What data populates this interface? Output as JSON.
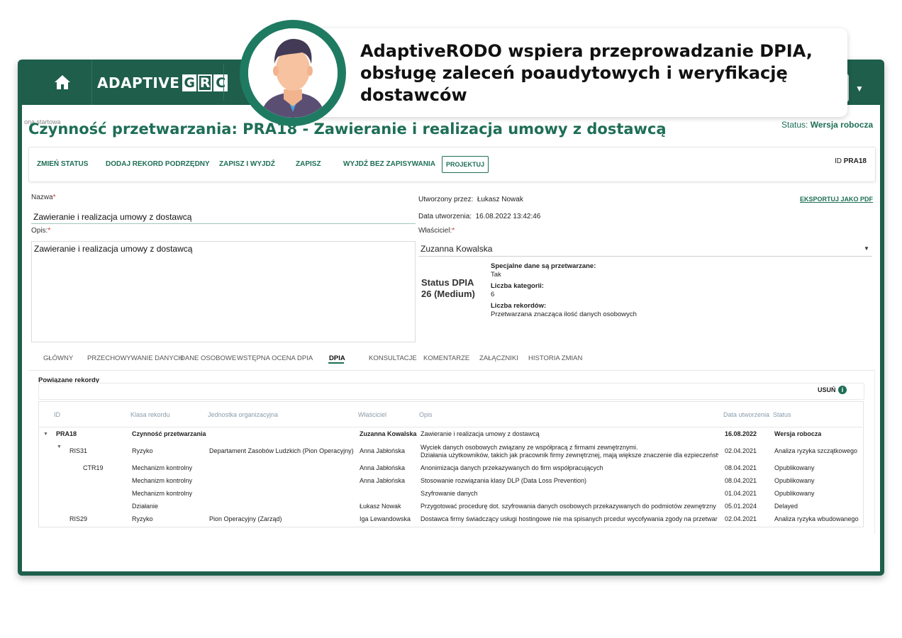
{
  "callout": {
    "text": "AdaptiveRODO wspiera przeprowadzanie DPIA, obsługę zaleceń poaudytowych i weryfikację dostawców"
  },
  "app": {
    "logo_text": "ADAPTIVE",
    "logo_letters": [
      "G",
      "R",
      "C"
    ],
    "accent_color": "#1e6e56"
  },
  "breadcrumb": "ona startowa",
  "page": {
    "title": "Czynność przetwarzania: PRA18 - Zawieranie i realizacja umowy z dostawcą",
    "status_label": "Status:",
    "status_value": "Wersja robocza"
  },
  "toolbar": {
    "change_status": "ZMIEŃ STATUS",
    "add_child": "DODAJ REKORD PODRZĘDNY",
    "save_exit": "ZAPISZ I WYJDŹ",
    "save": "ZAPISZ",
    "exit_no_save": "WYJDŹ BEZ ZAPISYWANIA",
    "design": "PROJEKTUJ",
    "id_label": "ID",
    "id_value": "PRA18"
  },
  "form": {
    "name_label": "Nazwa",
    "name_value": "Zawieranie i realizacja umowy z dostawcą",
    "desc_label": "Opis:",
    "desc_value": "Zawieranie i realizacja umowy z dostawcą",
    "created_by_label": "Utworzony przez:",
    "created_by_value": "Łukasz Nowak",
    "created_date_label": "Data utworzenia:",
    "created_date_value": "16.08.2022 13:42:46",
    "owner_label": "Właściciel:",
    "owner_value": "Zuzanna Kowalska",
    "export_label": "EKSPORTUJ JAKO PDF",
    "required_mark": "*"
  },
  "dpia": {
    "status_line1": "Status DPIA",
    "status_line2": "26 (Medium)",
    "special_label": "Specjalne dane są przetwarzane:",
    "special_value": "Tak",
    "categories_label": "Liczba kategorii:",
    "categories_value": "6",
    "records_label": "Liczba rekordów:",
    "records_value": "Przetwarzana znacząca ilość danych osobowych"
  },
  "tabs": [
    "GŁÓWNY",
    "PRZECHOWYWANIE DANYCH",
    "DANE OSOBOWE",
    "WSTĘPNA OCENA DPIA",
    "DPIA",
    "KONSULTACJE",
    "KOMENTARZE",
    "ZAŁĄCZNIKI",
    "HISTORIA ZMIAN"
  ],
  "related": {
    "title": "Powiązane rekordy",
    "remove_label": "USUŃ",
    "columns": [
      "ID",
      "Klasa rekordu",
      "Jednostka organizacyjna",
      "Właściciel",
      "Opis",
      "Data utworzenia",
      "Status"
    ],
    "rows": [
      {
        "id": "PRA18",
        "class": "Czynność przetwarzania",
        "unit": "",
        "owner": "Zuzanna Kowalska",
        "desc": "Zawieranie i realizacja umowy z dostawcą",
        "desc2": "",
        "date": "16.08.2022",
        "status": "Wersja robocza"
      },
      {
        "id": "RIS31",
        "class": "Ryzyko",
        "unit": "Departament Zasobów Ludzkich (Pion Operacyjny)",
        "owner": "Anna Jabłońska",
        "desc": "Wyciek danych osobowych związany ze współpracą z firmami zewnętrznymi.",
        "desc2": "Działania użytkowników, takich jak pracownik firmy zewnętrznej, mają większe znaczenie dla ezpieczeństw",
        "date": "02.04.2021",
        "status": "Analiza ryzyka szczątkowego"
      },
      {
        "id": "CTR19",
        "class": "Mechanizm kontrolny",
        "unit": "",
        "owner": "Anna Jabłońska",
        "desc": "Anonimizacja danych przekazywanych do firm współpracujących",
        "desc2": "",
        "date": "08.04.2021",
        "status": "Opublikowany"
      },
      {
        "id": "",
        "class": "Mechanizm kontrolny",
        "unit": "",
        "owner": "Anna Jabłońska",
        "desc": "Stosowanie rozwiązania klasy DLP (Data Loss Prevention)",
        "desc2": "",
        "date": "08.04.2021",
        "status": "Opublikowany"
      },
      {
        "id": "",
        "class": "Mechanizm kontrolny",
        "unit": "",
        "owner": "",
        "desc": "Szyfrowanie danych",
        "desc2": "",
        "date": "01.04.2021",
        "status": "Opublikowany"
      },
      {
        "id": "",
        "class": "Działanie",
        "unit": "",
        "owner": "Łukasz Nowak",
        "desc": "Przygotować procedurę dot. szyfrowania danych osobowych przekazywanych do podmiotów zewnętrzny",
        "desc2": "",
        "date": "05.01.2024",
        "status": "Delayed"
      },
      {
        "id": "RIS29",
        "class": "Ryzyko",
        "unit": "Pion Operacyjny (Zarząd)",
        "owner": "Iga Lewandowska",
        "desc": "Dostawca firmy świadczący usługi hostingowe nie ma spisanych prcedur wycofywania zgody na przetwar",
        "desc2": "",
        "date": "02.04.2021",
        "status": "Analiza ryzyka wbudowanego"
      }
    ]
  }
}
